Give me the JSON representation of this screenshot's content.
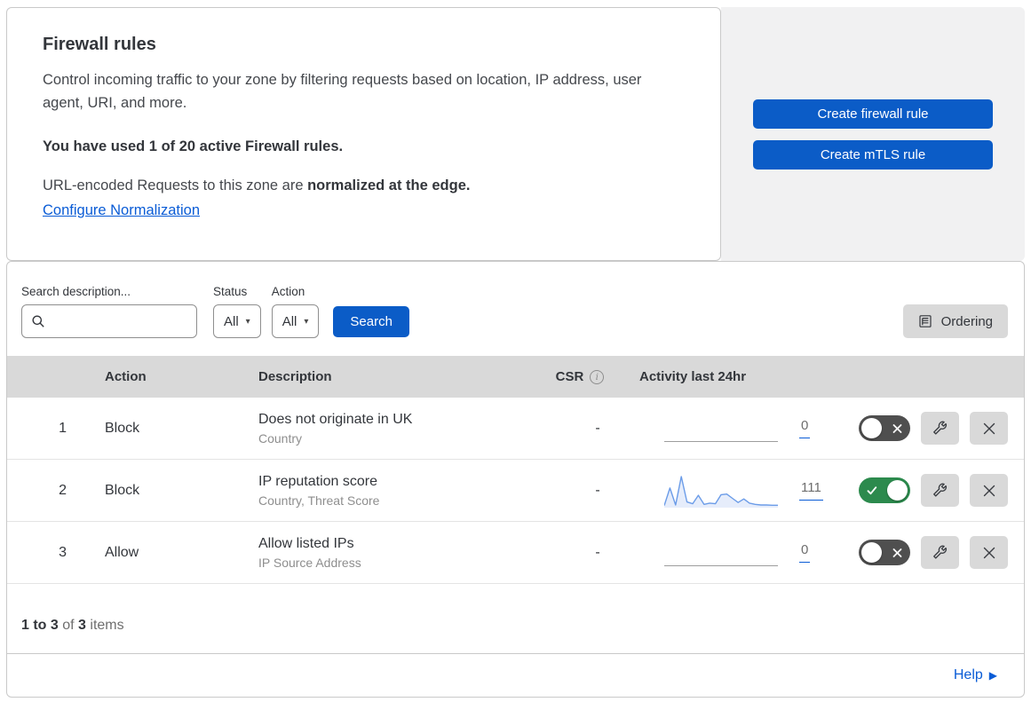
{
  "page": {
    "header_card": {
      "title": "Firewall rules",
      "description": "Control incoming traffic to your zone by filtering requests based on location, IP address, user agent, URI, and more.",
      "usage_bold": "You have used 1 of 20 active Firewall rules.",
      "normalization_prefix": "URL-encoded Requests to this zone are ",
      "normalization_bold": "normalized at the edge.",
      "normalization_link": "Configure Normalization"
    },
    "actions_panel": {
      "create_firewall_label": "Create firewall rule",
      "create_mtls_label": "Create mTLS rule"
    },
    "filters": {
      "search_label": "Search description...",
      "search_value": "",
      "status_label": "Status",
      "status_value": "All",
      "action_label": "Action",
      "action_value": "All",
      "search_button_label": "Search",
      "ordering_button_label": "Ordering"
    },
    "table": {
      "headers": {
        "action": "Action",
        "description": "Description",
        "csr": "CSR",
        "csr_info": "i",
        "activity": "Activity last 24hr"
      },
      "rows": [
        {
          "index": "1",
          "action": "Block",
          "description": "Does not originate in UK",
          "fields": "Country",
          "csr": "-",
          "count": "0",
          "enabled": false
        },
        {
          "index": "2",
          "action": "Block",
          "description": "IP reputation score",
          "fields": "Country, Threat Score",
          "csr": "-",
          "count": "111",
          "enabled": true,
          "sparkline": [
            4,
            62,
            6,
            100,
            16,
            10,
            38,
            8,
            12,
            10,
            40,
            42,
            28,
            14,
            26,
            12,
            8,
            6,
            6,
            5,
            5
          ]
        },
        {
          "index": "3",
          "action": "Allow",
          "description": "Allow listed IPs",
          "fields": "IP Source Address",
          "csr": "-",
          "count": "0",
          "enabled": false
        }
      ]
    },
    "footer": {
      "range_bold": "1 to 3",
      "of_text": " of ",
      "total_bold": "3",
      "items_text": " items",
      "help_label": "Help"
    },
    "colors": {
      "primary_blue": "#0b5cc7",
      "link_blue": "#0a5cd6",
      "toggle_on_green": "#2c8a4d",
      "toggle_off_gray": "#4f4f4f",
      "table_header_bg": "#d9d9d9",
      "panel_bg": "#f1f1f2",
      "sparkline_blue": "#6b9ce8"
    }
  }
}
